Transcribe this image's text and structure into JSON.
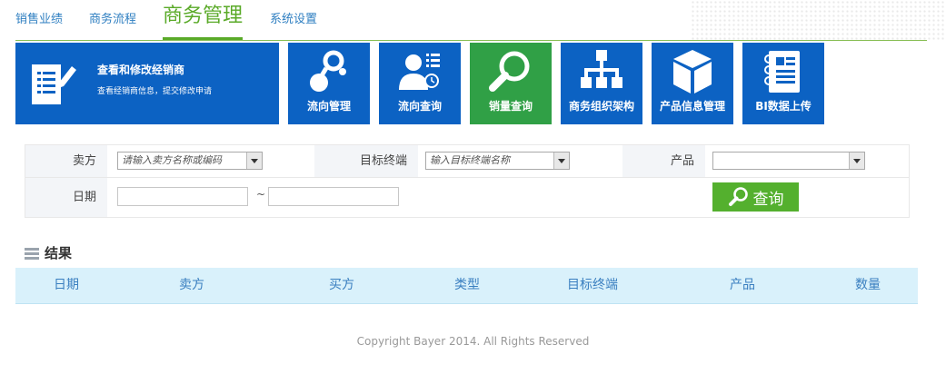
{
  "nav": {
    "items": [
      "销售业绩",
      "商务流程",
      "商务管理",
      "系统设置"
    ],
    "active": "商务管理"
  },
  "tiles": {
    "main": {
      "title": "查看和修改经销商",
      "subtitle": "查看经销商信息，提交修改申请"
    },
    "items": [
      "流向管理",
      "流向查询",
      "销量查询",
      "商务组织架构",
      "产品信息管理",
      "BI数据上传"
    ],
    "active": "销量查询"
  },
  "form": {
    "seller_label": "卖方",
    "seller_placeholder": "请输入卖方名称或编码",
    "target_label": "目标终端",
    "target_placeholder": "输入目标终端名称",
    "product_label": "产品",
    "product_value": "",
    "date_label": "日期",
    "date_separator": "~",
    "query_label": "查询"
  },
  "results": {
    "title": "结果",
    "columns": [
      "日期",
      "卖方",
      "买方",
      "类型",
      "目标终端",
      "产品",
      "数量"
    ]
  },
  "footer": "Copyright Bayer 2014. All Rights Reserved",
  "colors": {
    "tile_blue": "#0c62c3",
    "tile_green": "#30a046",
    "nav_active": "#5aaa28",
    "nav_link": "#2f7fc1",
    "table_header": "#d9f1fb"
  }
}
